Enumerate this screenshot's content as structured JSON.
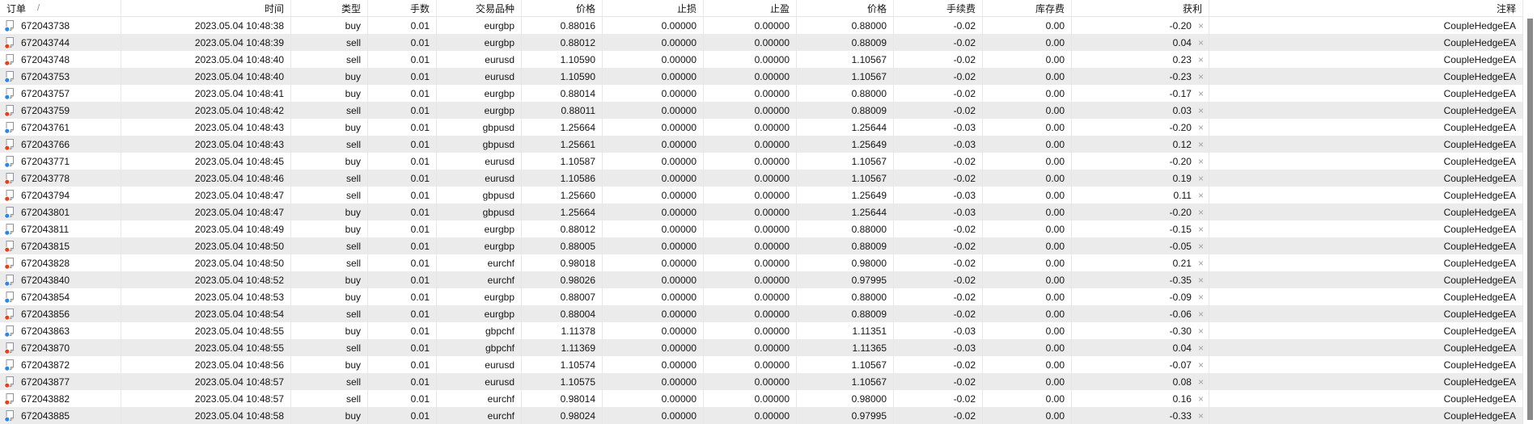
{
  "table": {
    "sort_indicator": "/",
    "close_icon": "×",
    "columns": [
      {
        "key": "order",
        "label": "订单",
        "align": "left"
      },
      {
        "key": "time",
        "label": "时间",
        "align": "right"
      },
      {
        "key": "type",
        "label": "类型",
        "align": "right"
      },
      {
        "key": "lots",
        "label": "手数",
        "align": "right"
      },
      {
        "key": "symbol",
        "label": "交易品种",
        "align": "right"
      },
      {
        "key": "price",
        "label": "价格",
        "align": "right"
      },
      {
        "key": "sl",
        "label": "止损",
        "align": "right"
      },
      {
        "key": "tp",
        "label": "止盈",
        "align": "right"
      },
      {
        "key": "close_price",
        "label": "价格",
        "align": "right"
      },
      {
        "key": "commission",
        "label": "手续费",
        "align": "right"
      },
      {
        "key": "swap",
        "label": "库存费",
        "align": "right"
      },
      {
        "key": "profit",
        "label": "获利",
        "align": "right"
      },
      {
        "key": "comment",
        "label": "注释",
        "align": "right"
      }
    ],
    "rows": [
      {
        "order": "672043738",
        "time": "2023.05.04 10:48:38",
        "type": "buy",
        "lots": "0.01",
        "symbol": "eurgbp",
        "price": "0.88016",
        "sl": "0.00000",
        "tp": "0.00000",
        "close_price": "0.88000",
        "commission": "-0.02",
        "swap": "0.00",
        "profit": "-0.20",
        "comment": "CoupleHedgeEA"
      },
      {
        "order": "672043744",
        "time": "2023.05.04 10:48:39",
        "type": "sell",
        "lots": "0.01",
        "symbol": "eurgbp",
        "price": "0.88012",
        "sl": "0.00000",
        "tp": "0.00000",
        "close_price": "0.88009",
        "commission": "-0.02",
        "swap": "0.00",
        "profit": "0.04",
        "comment": "CoupleHedgeEA"
      },
      {
        "order": "672043748",
        "time": "2023.05.04 10:48:40",
        "type": "sell",
        "lots": "0.01",
        "symbol": "eurusd",
        "price": "1.10590",
        "sl": "0.00000",
        "tp": "0.00000",
        "close_price": "1.10567",
        "commission": "-0.02",
        "swap": "0.00",
        "profit": "0.23",
        "comment": "CoupleHedgeEA"
      },
      {
        "order": "672043753",
        "time": "2023.05.04 10:48:40",
        "type": "buy",
        "lots": "0.01",
        "symbol": "eurusd",
        "price": "1.10590",
        "sl": "0.00000",
        "tp": "0.00000",
        "close_price": "1.10567",
        "commission": "-0.02",
        "swap": "0.00",
        "profit": "-0.23",
        "comment": "CoupleHedgeEA"
      },
      {
        "order": "672043757",
        "time": "2023.05.04 10:48:41",
        "type": "buy",
        "lots": "0.01",
        "symbol": "eurgbp",
        "price": "0.88014",
        "sl": "0.00000",
        "tp": "0.00000",
        "close_price": "0.88000",
        "commission": "-0.02",
        "swap": "0.00",
        "profit": "-0.17",
        "comment": "CoupleHedgeEA"
      },
      {
        "order": "672043759",
        "time": "2023.05.04 10:48:42",
        "type": "sell",
        "lots": "0.01",
        "symbol": "eurgbp",
        "price": "0.88011",
        "sl": "0.00000",
        "tp": "0.00000",
        "close_price": "0.88009",
        "commission": "-0.02",
        "swap": "0.00",
        "profit": "0.03",
        "comment": "CoupleHedgeEA"
      },
      {
        "order": "672043761",
        "time": "2023.05.04 10:48:43",
        "type": "buy",
        "lots": "0.01",
        "symbol": "gbpusd",
        "price": "1.25664",
        "sl": "0.00000",
        "tp": "0.00000",
        "close_price": "1.25644",
        "commission": "-0.03",
        "swap": "0.00",
        "profit": "-0.20",
        "comment": "CoupleHedgeEA"
      },
      {
        "order": "672043766",
        "time": "2023.05.04 10:48:43",
        "type": "sell",
        "lots": "0.01",
        "symbol": "gbpusd",
        "price": "1.25661",
        "sl": "0.00000",
        "tp": "0.00000",
        "close_price": "1.25649",
        "commission": "-0.03",
        "swap": "0.00",
        "profit": "0.12",
        "comment": "CoupleHedgeEA"
      },
      {
        "order": "672043771",
        "time": "2023.05.04 10:48:45",
        "type": "buy",
        "lots": "0.01",
        "symbol": "eurusd",
        "price": "1.10587",
        "sl": "0.00000",
        "tp": "0.00000",
        "close_price": "1.10567",
        "commission": "-0.02",
        "swap": "0.00",
        "profit": "-0.20",
        "comment": "CoupleHedgeEA"
      },
      {
        "order": "672043778",
        "time": "2023.05.04 10:48:46",
        "type": "sell",
        "lots": "0.01",
        "symbol": "eurusd",
        "price": "1.10586",
        "sl": "0.00000",
        "tp": "0.00000",
        "close_price": "1.10567",
        "commission": "-0.02",
        "swap": "0.00",
        "profit": "0.19",
        "comment": "CoupleHedgeEA"
      },
      {
        "order": "672043794",
        "time": "2023.05.04 10:48:47",
        "type": "sell",
        "lots": "0.01",
        "symbol": "gbpusd",
        "price": "1.25660",
        "sl": "0.00000",
        "tp": "0.00000",
        "close_price": "1.25649",
        "commission": "-0.03",
        "swap": "0.00",
        "profit": "0.11",
        "comment": "CoupleHedgeEA"
      },
      {
        "order": "672043801",
        "time": "2023.05.04 10:48:47",
        "type": "buy",
        "lots": "0.01",
        "symbol": "gbpusd",
        "price": "1.25664",
        "sl": "0.00000",
        "tp": "0.00000",
        "close_price": "1.25644",
        "commission": "-0.03",
        "swap": "0.00",
        "profit": "-0.20",
        "comment": "CoupleHedgeEA"
      },
      {
        "order": "672043811",
        "time": "2023.05.04 10:48:49",
        "type": "buy",
        "lots": "0.01",
        "symbol": "eurgbp",
        "price": "0.88012",
        "sl": "0.00000",
        "tp": "0.00000",
        "close_price": "0.88000",
        "commission": "-0.02",
        "swap": "0.00",
        "profit": "-0.15",
        "comment": "CoupleHedgeEA"
      },
      {
        "order": "672043815",
        "time": "2023.05.04 10:48:50",
        "type": "sell",
        "lots": "0.01",
        "symbol": "eurgbp",
        "price": "0.88005",
        "sl": "0.00000",
        "tp": "0.00000",
        "close_price": "0.88009",
        "commission": "-0.02",
        "swap": "0.00",
        "profit": "-0.05",
        "comment": "CoupleHedgeEA"
      },
      {
        "order": "672043828",
        "time": "2023.05.04 10:48:50",
        "type": "sell",
        "lots": "0.01",
        "symbol": "eurchf",
        "price": "0.98018",
        "sl": "0.00000",
        "tp": "0.00000",
        "close_price": "0.98000",
        "commission": "-0.02",
        "swap": "0.00",
        "profit": "0.21",
        "comment": "CoupleHedgeEA"
      },
      {
        "order": "672043840",
        "time": "2023.05.04 10:48:52",
        "type": "buy",
        "lots": "0.01",
        "symbol": "eurchf",
        "price": "0.98026",
        "sl": "0.00000",
        "tp": "0.00000",
        "close_price": "0.97995",
        "commission": "-0.02",
        "swap": "0.00",
        "profit": "-0.35",
        "comment": "CoupleHedgeEA"
      },
      {
        "order": "672043854",
        "time": "2023.05.04 10:48:53",
        "type": "buy",
        "lots": "0.01",
        "symbol": "eurgbp",
        "price": "0.88007",
        "sl": "0.00000",
        "tp": "0.00000",
        "close_price": "0.88000",
        "commission": "-0.02",
        "swap": "0.00",
        "profit": "-0.09",
        "comment": "CoupleHedgeEA"
      },
      {
        "order": "672043856",
        "time": "2023.05.04 10:48:54",
        "type": "sell",
        "lots": "0.01",
        "symbol": "eurgbp",
        "price": "0.88004",
        "sl": "0.00000",
        "tp": "0.00000",
        "close_price": "0.88009",
        "commission": "-0.02",
        "swap": "0.00",
        "profit": "-0.06",
        "comment": "CoupleHedgeEA"
      },
      {
        "order": "672043863",
        "time": "2023.05.04 10:48:55",
        "type": "buy",
        "lots": "0.01",
        "symbol": "gbpchf",
        "price": "1.11378",
        "sl": "0.00000",
        "tp": "0.00000",
        "close_price": "1.11351",
        "commission": "-0.03",
        "swap": "0.00",
        "profit": "-0.30",
        "comment": "CoupleHedgeEA"
      },
      {
        "order": "672043870",
        "time": "2023.05.04 10:48:55",
        "type": "sell",
        "lots": "0.01",
        "symbol": "gbpchf",
        "price": "1.11369",
        "sl": "0.00000",
        "tp": "0.00000",
        "close_price": "1.11365",
        "commission": "-0.03",
        "swap": "0.00",
        "profit": "0.04",
        "comment": "CoupleHedgeEA"
      },
      {
        "order": "672043872",
        "time": "2023.05.04 10:48:56",
        "type": "buy",
        "lots": "0.01",
        "symbol": "eurusd",
        "price": "1.10574",
        "sl": "0.00000",
        "tp": "0.00000",
        "close_price": "1.10567",
        "commission": "-0.02",
        "swap": "0.00",
        "profit": "-0.07",
        "comment": "CoupleHedgeEA"
      },
      {
        "order": "672043877",
        "time": "2023.05.04 10:48:57",
        "type": "sell",
        "lots": "0.01",
        "symbol": "eurusd",
        "price": "1.10575",
        "sl": "0.00000",
        "tp": "0.00000",
        "close_price": "1.10567",
        "commission": "-0.02",
        "swap": "0.00",
        "profit": "0.08",
        "comment": "CoupleHedgeEA"
      },
      {
        "order": "672043882",
        "time": "2023.05.04 10:48:57",
        "type": "sell",
        "lots": "0.01",
        "symbol": "eurchf",
        "price": "0.98014",
        "sl": "0.00000",
        "tp": "0.00000",
        "close_price": "0.98000",
        "commission": "-0.02",
        "swap": "0.00",
        "profit": "0.16",
        "comment": "CoupleHedgeEA"
      },
      {
        "order": "672043885",
        "time": "2023.05.04 10:48:58",
        "type": "buy",
        "lots": "0.01",
        "symbol": "eurchf",
        "price": "0.98024",
        "sl": "0.00000",
        "tp": "0.00000",
        "close_price": "0.97995",
        "commission": "-0.02",
        "swap": "0.00",
        "profit": "-0.33",
        "comment": "CoupleHedgeEA"
      }
    ]
  },
  "colors": {
    "buy_dot": "#2e86e8",
    "sell_dot": "#e8401c",
    "alt_row": "#ebebeb",
    "close_icon": "#a3a3a3",
    "scrollbar_thumb": "#8a8a8a"
  }
}
